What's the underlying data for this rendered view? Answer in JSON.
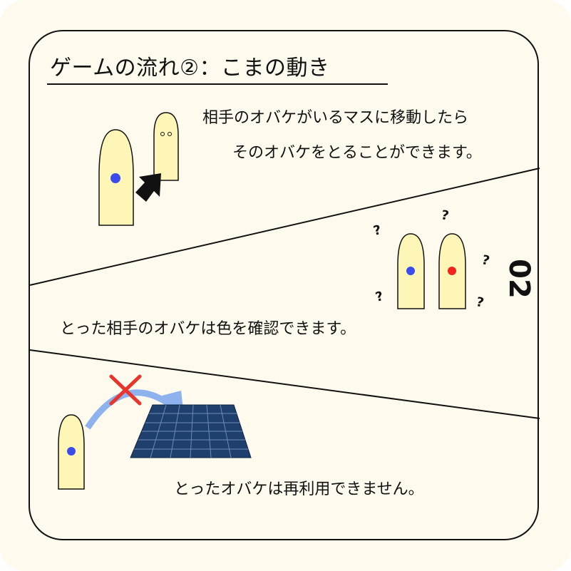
{
  "title": "ゲームの流れ②：こまの動き",
  "steps": [
    {
      "line1": "相手のオバケがいるマスに移動したら",
      "line2": "そのオバケをとることができます。"
    },
    {
      "text": "とった相手のオバケは色を確認できます。"
    },
    {
      "text": "とったオバケは再利用できません。"
    }
  ],
  "code": "02",
  "question_mark": "?",
  "colors": {
    "piece": "#fdf6b6",
    "blue": "#3b4bec",
    "red": "#f0241d",
    "cross": "#e8342a",
    "arrow": "#8eb2ee",
    "board": "#1f3f6c"
  },
  "icons": [
    "black-arrow-icon",
    "curved-arrow-icon",
    "cross-icon",
    "board-image"
  ]
}
